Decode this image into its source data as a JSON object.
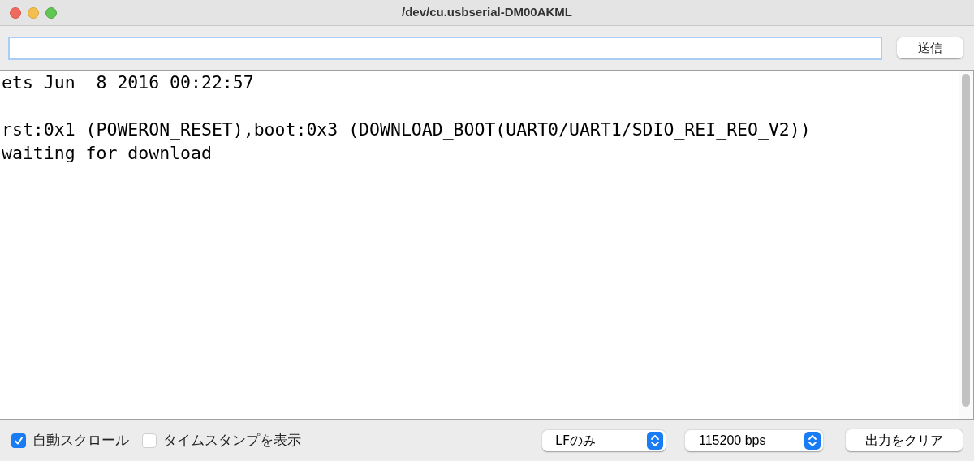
{
  "window": {
    "title": "/dev/cu.usbserial-DM00AKML"
  },
  "send_bar": {
    "send_button": "送信"
  },
  "output": {
    "paragraphs": [
      [
        "ets Jun  8 2016 00:22:57"
      ],
      [
        "rst:0x1 (POWERON_RESET),boot:0x3 (DOWNLOAD_BOOT(UART0/UART1/SDIO_REI_REO_V2))",
        "waiting for download"
      ]
    ]
  },
  "footer": {
    "checkboxes": [
      {
        "label": "自動スクロール",
        "checked": true
      },
      {
        "label": "タイムスタンプを表示",
        "checked": false
      }
    ],
    "line_ending": "LFのみ",
    "baud_rate": "115200 bps",
    "clear_button": "出力をクリア"
  }
}
